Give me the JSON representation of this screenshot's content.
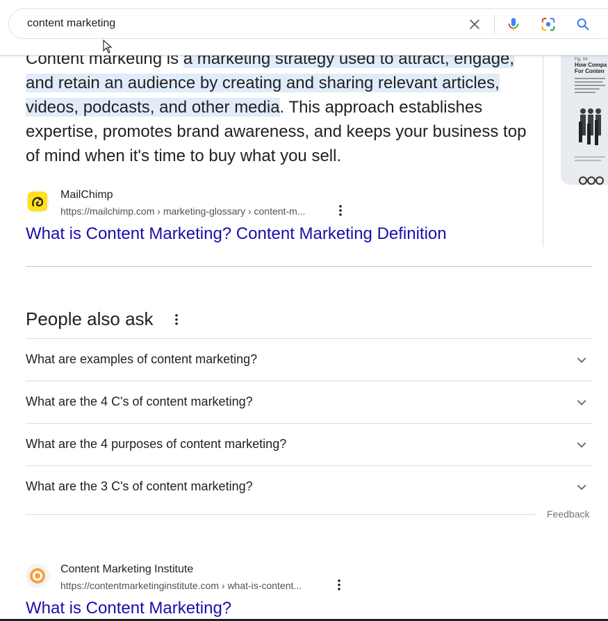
{
  "search": {
    "query": "content marketing"
  },
  "snippet": {
    "text_before": "Content marketing is ",
    "highlighted": "a marketing strategy used to attract, engage, and retain an audience by creating and sharing relevant articles, videos, podcasts, and other media",
    "text_after": ". This approach establishes expertise, promotes brand awareness, and keeps your business top of mind when it's time to buy what you sell."
  },
  "thumbnail": {
    "label_fig": "Fig. 04",
    "label_title_1": "How Compa",
    "label_title_2": "For Conten"
  },
  "results": [
    {
      "source": "MailChimp",
      "url": "https://mailchimp.com › marketing-glossary › content-m...",
      "title": "What is Content Marketing? Content Marketing Definition"
    },
    {
      "source": "Content Marketing Institute",
      "url": "https://contentmarketinginstitute.com › what-is-content...",
      "title": "What is Content Marketing?"
    }
  ],
  "paa": {
    "title": "People also ask",
    "questions": [
      "What are examples of content marketing?",
      "What are the 4 C's of content marketing?",
      "What are the 4 purposes of content marketing?",
      "What are the 3 C's of content marketing?"
    ]
  },
  "feedback": "Feedback",
  "icons": {
    "clear": "close-icon",
    "voice": "microphone-icon",
    "lens": "lens-icon",
    "search": "search-icon",
    "more": "more-vert-icon",
    "expand": "chevron-down-icon"
  },
  "colors": {
    "link": "#1a0dab",
    "highlight": "#e1ecfa",
    "search_blue": "#4285f4"
  }
}
